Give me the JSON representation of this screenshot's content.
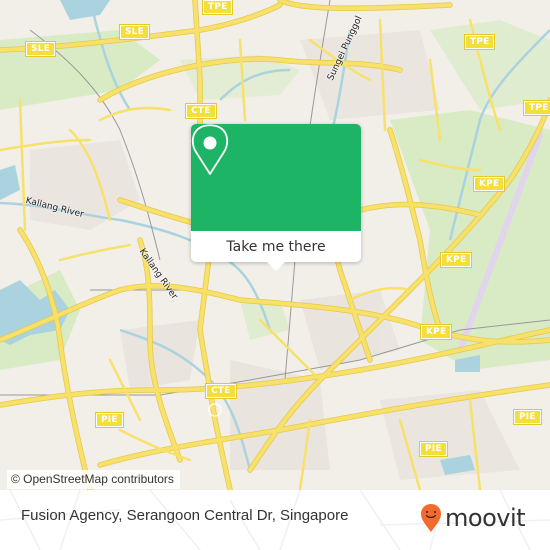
{
  "map": {
    "highway_shields": [
      {
        "id": "sle-1",
        "label": "SLE"
      },
      {
        "id": "sle-2",
        "label": "SLE"
      },
      {
        "id": "tpe-1",
        "label": "TPE"
      },
      {
        "id": "tpe-2",
        "label": "TPE"
      },
      {
        "id": "tpe-3",
        "label": "TPE"
      },
      {
        "id": "cte-1",
        "label": "CTE"
      },
      {
        "id": "cte-2",
        "label": "CTE"
      },
      {
        "id": "kpe-1",
        "label": "KPE"
      },
      {
        "id": "kpe-2",
        "label": "KPE"
      },
      {
        "id": "kpe-3",
        "label": "KPE"
      },
      {
        "id": "pie-1",
        "label": "PIE"
      },
      {
        "id": "pie-2",
        "label": "PIE"
      },
      {
        "id": "pie-3",
        "label": "PIE"
      },
      {
        "id": "pie-4",
        "label": "PIE"
      }
    ],
    "labels": {
      "kallang_river_1": "Kallang River",
      "kallang_river_2": "Kallang River",
      "sungei_punggol": "Sungei Punggol"
    },
    "attribution": "© OpenStreetMap contributors",
    "colors": {
      "land": "#f2efe9",
      "park": "#d8ebc4",
      "water": "#aad3df",
      "road": "#f7e16a",
      "road_edge": "#e6c84a",
      "runway": "#e0d4ee"
    }
  },
  "popup": {
    "button_label": "Take me there",
    "accent_color": "#1db565"
  },
  "footer": {
    "place_title": "Fusion Agency, Serangoon Central Dr, Singapore",
    "brand_name": "moovit",
    "brand_color": "#f26a2e"
  }
}
